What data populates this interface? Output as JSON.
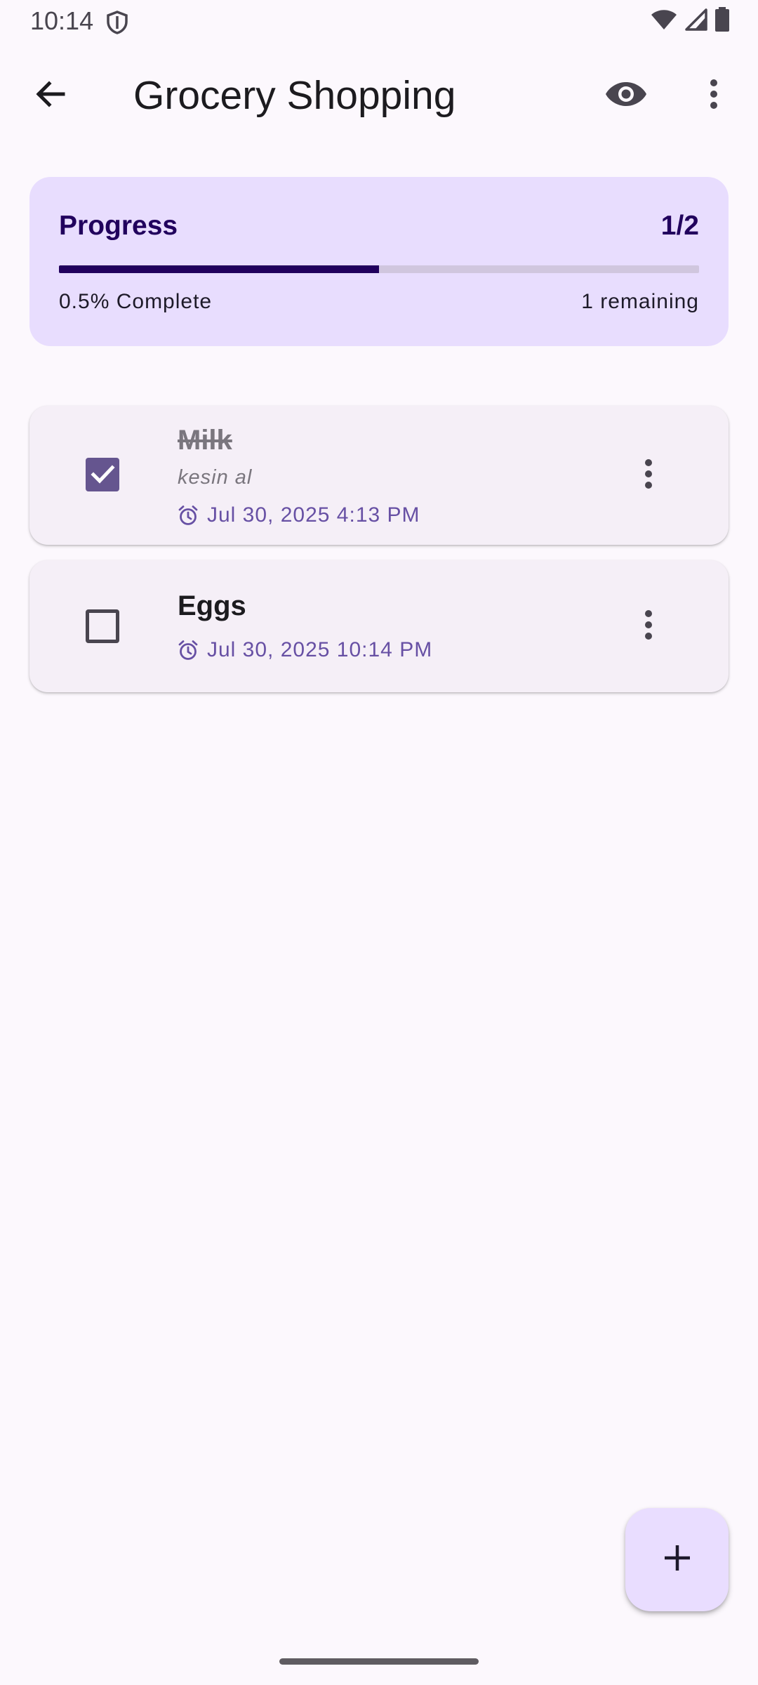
{
  "status_bar": {
    "time": "10:14",
    "icons": [
      "shield-icon",
      "wifi-icon",
      "signal-icon",
      "battery-icon"
    ]
  },
  "app_bar": {
    "title": "Grocery Shopping",
    "icons": [
      "back-arrow-icon",
      "eye-icon",
      "more-vert-icon"
    ]
  },
  "progress": {
    "label": "Progress",
    "count": "1/2",
    "fraction_filled": 0.5,
    "percent_text": "0.5% Complete",
    "remaining_text": "1 remaining"
  },
  "items": [
    {
      "name": "Milk",
      "checked": true,
      "note": "kesin al",
      "date": "Jul 30, 2025 4:13 PM"
    },
    {
      "name": "Eggs",
      "checked": false,
      "note": "",
      "date": "Jul 30, 2025 10:14 PM"
    }
  ],
  "fab_icon": "add-icon",
  "colors": {
    "background": "#fcf8fd",
    "progress_card": "#e8ddfe",
    "progress_fill": "#21005d",
    "progress_track": "#d0c6de",
    "checkbox_checked": "#65558f",
    "date_text": "#6750a4",
    "card": "#f5eff7",
    "fab": "#e9ddff"
  }
}
